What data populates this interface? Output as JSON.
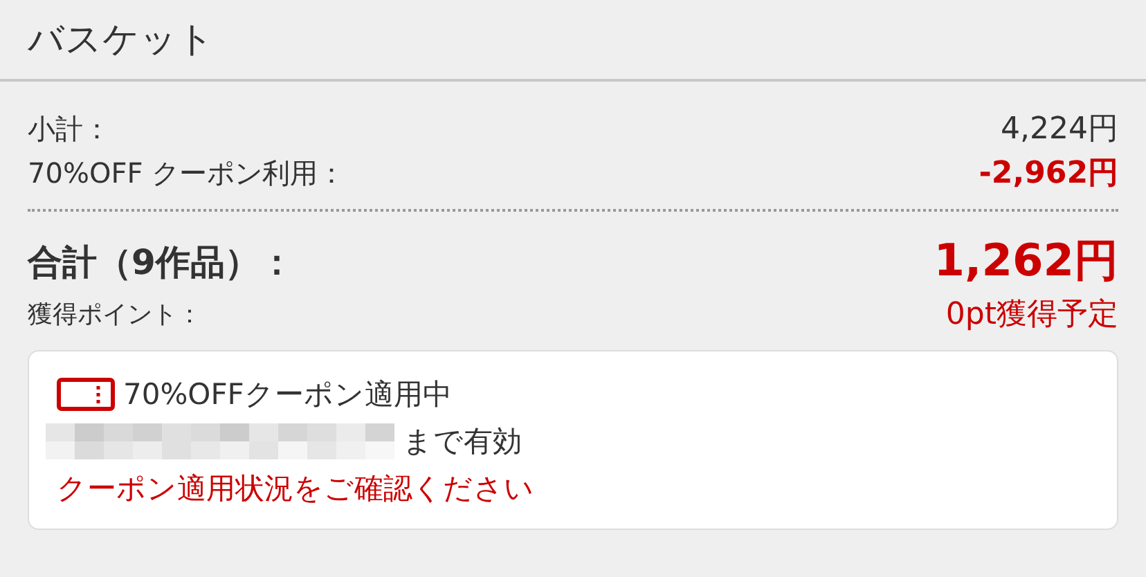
{
  "header": {
    "title": "バスケット"
  },
  "summary": {
    "subtotal": {
      "label": "小計：",
      "value": "4,224円"
    },
    "discount": {
      "label": "70%OFF クーポン利用：",
      "value": "-2,962円"
    },
    "total": {
      "label": "合計（9作品）：",
      "value": "1,262円"
    },
    "points": {
      "label": "獲得ポイント：",
      "value": "0pt獲得予定"
    }
  },
  "coupon": {
    "title": "70%OFFクーポン適用中",
    "validity": "まで有効",
    "notice": "クーポン適用状況をご確認ください"
  }
}
